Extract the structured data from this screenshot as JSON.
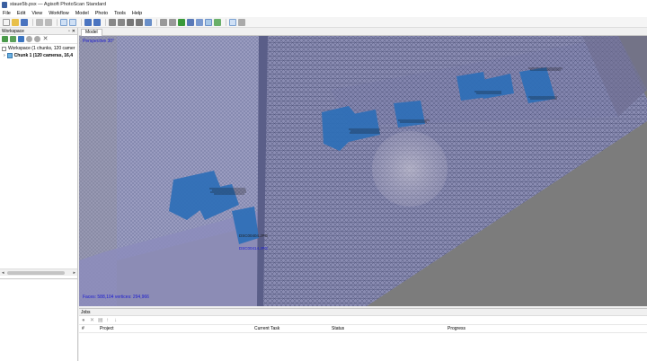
{
  "window": {
    "title": "staue5b.psx — Agisoft PhotoScan Standard"
  },
  "menu": [
    "File",
    "Edit",
    "View",
    "Workflow",
    "Model",
    "Photo",
    "Tools",
    "Help"
  ],
  "workspace_panel": {
    "title": "Workspace",
    "root_label": "Workspace (1 chunks, 120 camer",
    "chunk_label": "Chunk 1 (120 cameras, 16,4"
  },
  "model_tab": {
    "label": "Model"
  },
  "viewport": {
    "projection": "Perspective 30°",
    "stats": "Faces: 588,104 vertices: 294,966",
    "camera_labels": [
      "DSC00404.JPG",
      "DSC00414.JPG"
    ]
  },
  "jobs": {
    "title": "Jobs",
    "columns": [
      "#",
      "Project",
      "Current Task",
      "Status",
      "Progress"
    ]
  },
  "colors": {
    "camera_planes": "#2d6fb8",
    "mesh": "#8c8fb5",
    "background": "#7d7d7d"
  }
}
